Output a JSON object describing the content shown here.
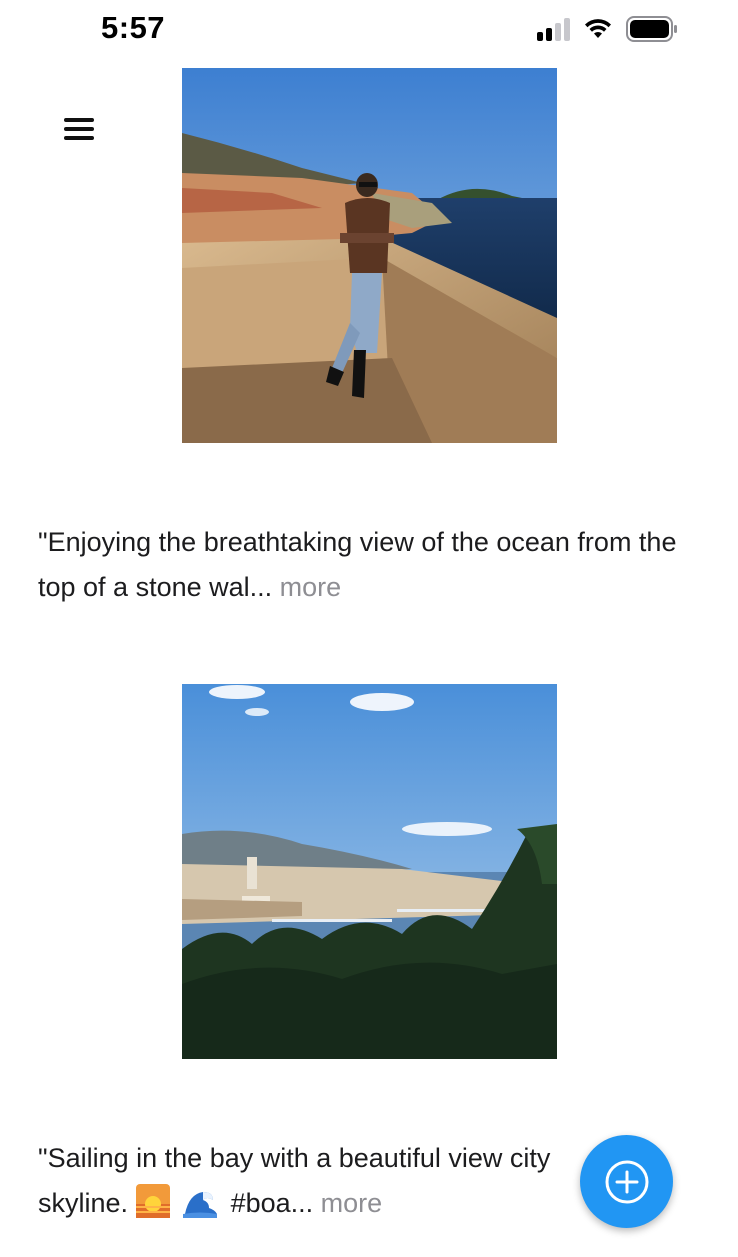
{
  "status_bar": {
    "time": "5:57",
    "signal_icon": "cellular-signal-icon",
    "wifi_icon": "wifi-icon",
    "battery_icon": "battery-icon"
  },
  "header": {
    "menu_icon": "hamburger-menu-icon"
  },
  "feed": {
    "posts": [
      {
        "caption": "\"Enjoying the breathtaking view of the ocean from the top of a stone wal...",
        "more_label": "more"
      },
      {
        "caption_start": "\"Sailing in the bay with a beautiful view city skyline.",
        "emojis": [
          "sunrise-emoji",
          "wave-emoji"
        ],
        "caption_end": "#boa...",
        "more_label": "more"
      }
    ]
  },
  "fab": {
    "icon": "plus-circle-icon",
    "color": "#2196f3"
  },
  "colors": {
    "accent": "#2196f3",
    "more_text": "#8e8e93"
  }
}
